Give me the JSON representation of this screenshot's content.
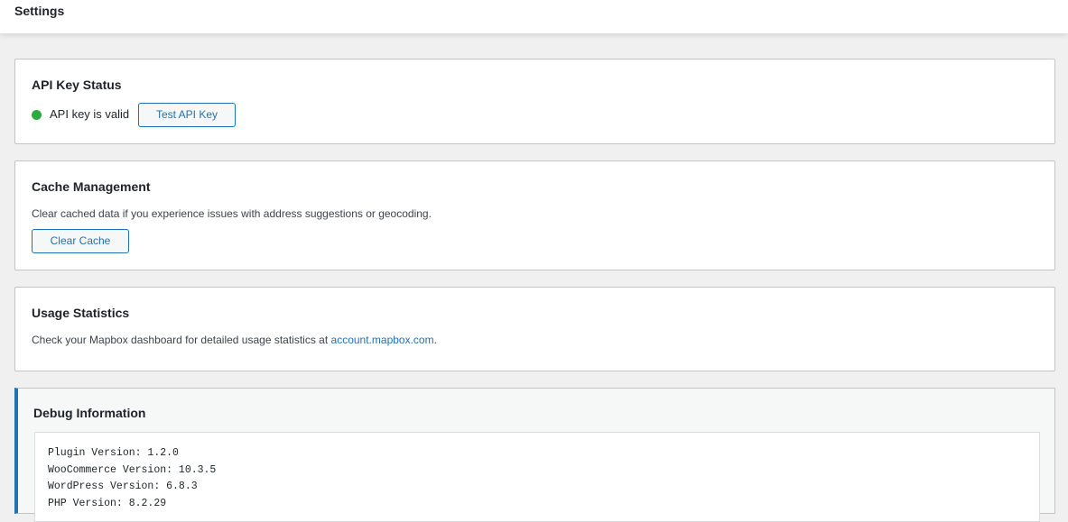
{
  "header": {
    "title": "Settings"
  },
  "api_key": {
    "title": "API Key Status",
    "status_text": "API key is valid",
    "status_color": "#2eaa3f",
    "test_button": "Test API Key"
  },
  "cache": {
    "title": "Cache Management",
    "description": "Clear cached data if you experience issues with address suggestions or geocoding.",
    "clear_button": "Clear Cache"
  },
  "usage": {
    "title": "Usage Statistics",
    "description_prefix": "Check your Mapbox dashboard for detailed usage statistics at ",
    "link_text": "account.mapbox.com",
    "description_suffix": "."
  },
  "debug": {
    "title": "Debug Information",
    "lines": [
      "Plugin Version: 1.2.0",
      "WooCommerce Version: 10.3.5",
      "WordPress Version: 6.8.3",
      "PHP Version: 8.2.29"
    ]
  },
  "colors": {
    "accent": "#2271b1",
    "success": "#2eaa3f"
  }
}
